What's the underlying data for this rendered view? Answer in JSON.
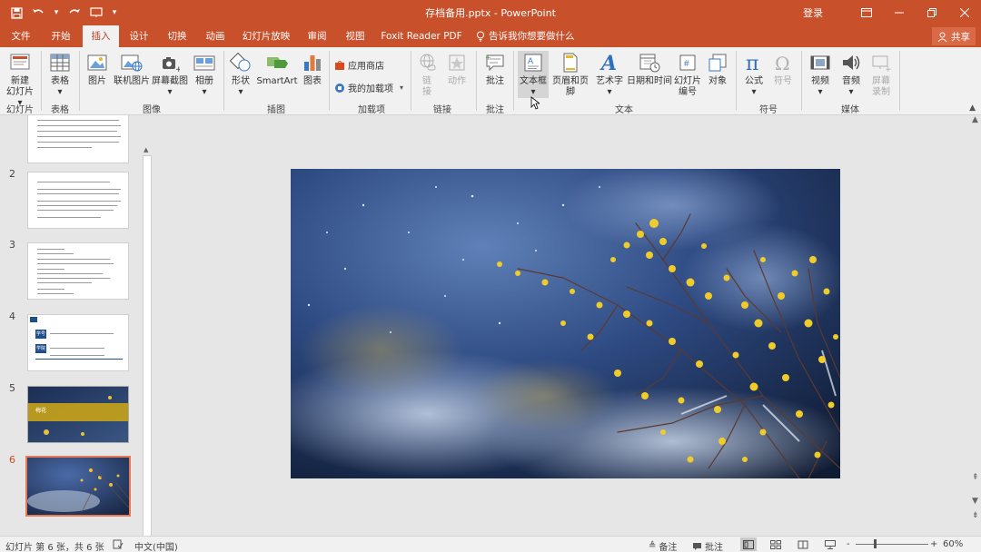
{
  "title_bar": {
    "document_title": "存档备用.pptx - PowerPoint",
    "signin_label": "登录",
    "qat": {
      "save_icon": "save-icon",
      "undo_icon": "undo-icon",
      "redo_icon": "redo-icon",
      "customize_icon": "customize-icon"
    }
  },
  "tabs": [
    {
      "label": "文件"
    },
    {
      "label": "开始"
    },
    {
      "label": "插入"
    },
    {
      "label": "设计"
    },
    {
      "label": "切换"
    },
    {
      "label": "动画"
    },
    {
      "label": "幻灯片放映"
    },
    {
      "label": "审阅"
    },
    {
      "label": "视图"
    },
    {
      "label": "Foxit Reader PDF"
    }
  ],
  "active_tab": "插入",
  "tell_me": "告诉我你想要做什么",
  "share_label": "共享",
  "ribbon": {
    "groups": {
      "slides": "幻灯片",
      "tables": "表格",
      "images": "图像",
      "illustrations": "插图",
      "addins": "加载项",
      "links": "链接",
      "comments": "批注",
      "text": "文本",
      "symbols": "符号",
      "media": "媒体"
    },
    "buttons": {
      "new_slide_1": "新建",
      "new_slide_2": "幻灯片",
      "table": "表格",
      "picture": "图片",
      "online_picture": "联机图片",
      "screenshot": "屏幕截图",
      "album": "相册",
      "shapes": "形状",
      "smartart": "SmartArt",
      "chart": "图表",
      "store": "应用商店",
      "my_addins": "我的加载项",
      "link_1": "链",
      "link_2": "接",
      "action": "动作",
      "comment": "批注",
      "textbox": "文本框",
      "header_footer": "页眉和页脚",
      "wordart": "艺术字",
      "datetime": "日期和时间",
      "slide_number_1": "幻灯片",
      "slide_number_2": "编号",
      "object": "对象",
      "equation": "公式",
      "symbol": "符号",
      "video": "视频",
      "audio": "音频",
      "screen_record_1": "屏幕",
      "screen_record_2": "录制"
    }
  },
  "thumbnails": [
    {
      "number": "2"
    },
    {
      "number": "3"
    },
    {
      "number": "4"
    },
    {
      "number": "5"
    },
    {
      "number": "6"
    }
  ],
  "thumb4": {
    "label_a": "学号",
    "label_b": "学院"
  },
  "thumb5": {
    "title": "梅花"
  },
  "status": {
    "slide_info": "幻灯片 第 6 张，共 6 张",
    "language": "中文(中国)",
    "notes": "备注",
    "comments": "批注",
    "zoom_minus": "-",
    "zoom_plus": "+",
    "zoom": "60%"
  },
  "colors": {
    "accent": "#c8502a",
    "ribbon": "#f1f1f1",
    "selected_thumb": "#e87b57"
  }
}
